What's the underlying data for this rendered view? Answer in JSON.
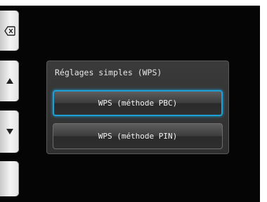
{
  "side_buttons": {
    "back": {
      "icon": "backspace-icon"
    },
    "up": {
      "icon": "arrow-up-icon"
    },
    "down": {
      "icon": "arrow-down-icon"
    },
    "extra": {
      "icon": ""
    }
  },
  "dialog": {
    "title": "Réglages simples (WPS)",
    "options": [
      {
        "label": "WPS (méthode PBC)",
        "selected": true
      },
      {
        "label": "WPS (méthode PIN)",
        "selected": false
      }
    ]
  },
  "colors": {
    "selection_border": "#1e9fd6",
    "screen_background": "#050505",
    "dialog_background": "#353535"
  }
}
